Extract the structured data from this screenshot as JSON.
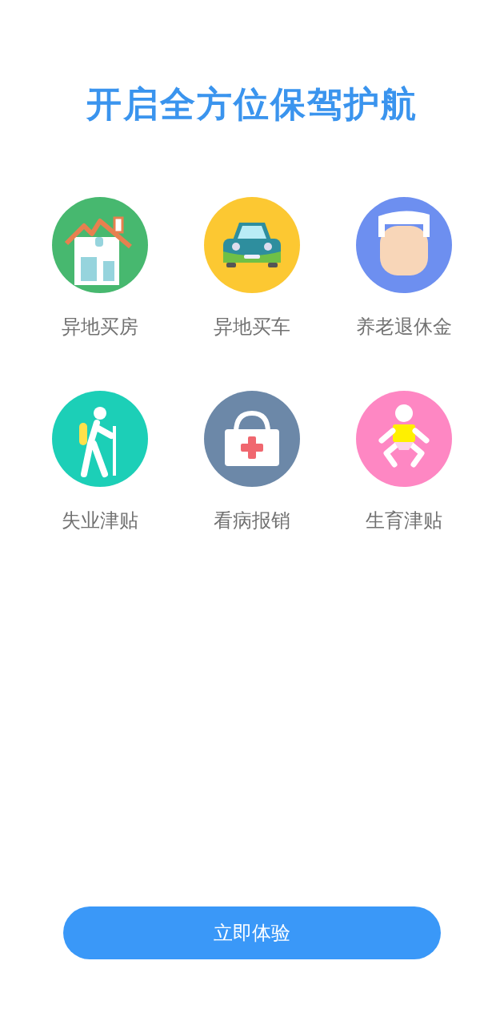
{
  "title": "开启全方位保驾护航",
  "features": [
    {
      "kind": "house",
      "label": "异地买房"
    },
    {
      "kind": "car",
      "label": "异地买车"
    },
    {
      "kind": "elder",
      "label": "养老退休金"
    },
    {
      "kind": "hiker",
      "label": "失业津贴"
    },
    {
      "kind": "medkit",
      "label": "看病报销"
    },
    {
      "kind": "baby",
      "label": "生育津贴"
    }
  ],
  "button": {
    "label": "立即体验"
  }
}
